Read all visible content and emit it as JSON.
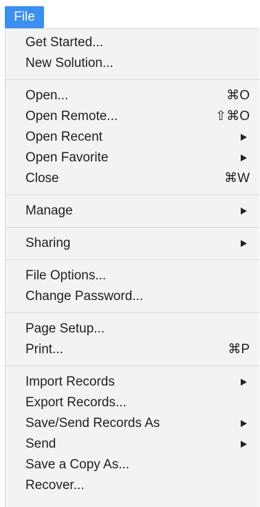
{
  "menu_title": "File",
  "groups": [
    {
      "items": [
        {
          "label": "Get Started...",
          "shortcut": "",
          "submenu": false
        },
        {
          "label": "New Solution...",
          "shortcut": "",
          "submenu": false
        }
      ]
    },
    {
      "items": [
        {
          "label": "Open...",
          "shortcut": "⌘O",
          "submenu": false
        },
        {
          "label": "Open Remote...",
          "shortcut": "⇧⌘O",
          "submenu": false
        },
        {
          "label": "Open Recent",
          "shortcut": "",
          "submenu": true
        },
        {
          "label": "Open Favorite",
          "shortcut": "",
          "submenu": true
        },
        {
          "label": "Close",
          "shortcut": "⌘W",
          "submenu": false
        }
      ]
    },
    {
      "items": [
        {
          "label": "Manage",
          "shortcut": "",
          "submenu": true
        }
      ]
    },
    {
      "items": [
        {
          "label": "Sharing",
          "shortcut": "",
          "submenu": true
        }
      ]
    },
    {
      "items": [
        {
          "label": "File Options...",
          "shortcut": "",
          "submenu": false
        },
        {
          "label": "Change Password...",
          "shortcut": "",
          "submenu": false
        }
      ]
    },
    {
      "items": [
        {
          "label": "Page Setup...",
          "shortcut": "",
          "submenu": false
        },
        {
          "label": "Print...",
          "shortcut": "⌘P",
          "submenu": false
        }
      ]
    },
    {
      "items": [
        {
          "label": "Import Records",
          "shortcut": "",
          "submenu": true
        },
        {
          "label": "Export Records...",
          "shortcut": "",
          "submenu": false
        },
        {
          "label": "Save/Send Records As",
          "shortcut": "",
          "submenu": true
        },
        {
          "label": "Send",
          "shortcut": "",
          "submenu": true
        },
        {
          "label": "Save a Copy As...",
          "shortcut": "",
          "submenu": false
        },
        {
          "label": "Recover...",
          "shortcut": "",
          "submenu": false
        }
      ]
    }
  ],
  "colors": {
    "menu_title_bg": "#3b8ff0",
    "menu_bg": "#f3f3f3",
    "separator": "#d9d9d9",
    "text": "#1f1f1f"
  },
  "icons": {
    "submenu": "submenu-arrow-icon"
  }
}
